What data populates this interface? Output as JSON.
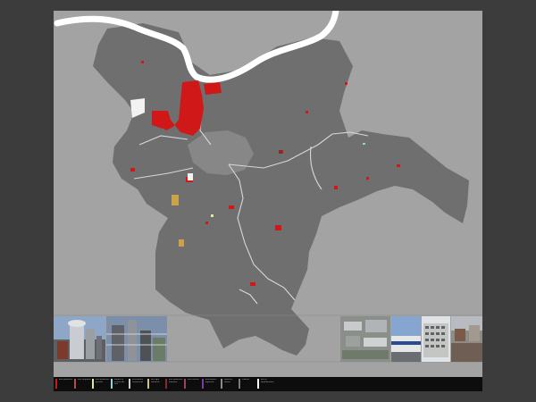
{
  "map": {
    "colors": {
      "background": "#3c3c3c",
      "panel": "#a3a3a3",
      "municipality": "#6f6f6f",
      "river": "#ffffff",
      "industrial": "#d01818",
      "roads": "#d8d8d8"
    }
  },
  "photos": {
    "left": [
      {
        "subject": "industrial-plant-towers"
      },
      {
        "subject": "industrial-plant-structure"
      }
    ],
    "right": [
      {
        "subject": "aerial-industrial-area"
      },
      {
        "subject": "warehouse-building"
      },
      {
        "subject": "office-block"
      },
      {
        "subject": "rural-buildings"
      }
    ]
  },
  "legend": {
    "items": [
      {
        "label": "aree produttive",
        "color": "#c81a1a"
      },
      {
        "label": "aree artigianali",
        "color": "#b84a4a"
      },
      {
        "label": "aree produttive previste",
        "color": "#e6e69a"
      },
      {
        "label": "impianti di servizio alle fonti",
        "color": "#8ad6d6"
      },
      {
        "label": "attrezzature commerciali",
        "color": "#cfcfcf"
      },
      {
        "label": "aree agro industriali",
        "color": "#d2c27a"
      },
      {
        "label": "aree produttive dismesse",
        "color": "#8a2a2a"
      },
      {
        "label": "aree ricettive",
        "color": "#a04060"
      },
      {
        "label": "attrezzature logistiche",
        "color": "#7a3aa0"
      },
      {
        "label": "ambiente urbano",
        "color": "#8a8a8a"
      },
      {
        "label": "viabilità",
        "color": "#7a7a7a"
      },
      {
        "label": "aree di riqualificazione",
        "color": "#ffffff"
      }
    ]
  }
}
